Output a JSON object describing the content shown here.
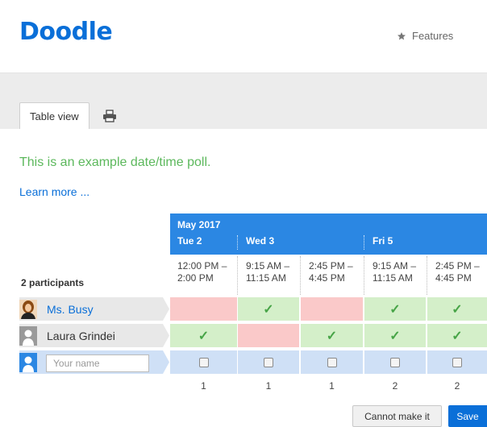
{
  "app": {
    "logo": "Doodle",
    "features_label": "Features"
  },
  "tabs": [
    {
      "label": "Table view"
    }
  ],
  "poll": {
    "title": "This is an example date/time poll.",
    "learn_more": "Learn more ..."
  },
  "calendar": {
    "month": "May 2017",
    "days": [
      "Tue 2",
      "Wed 3",
      "Fri 5"
    ],
    "participants_label": "2 participants",
    "slots": [
      {
        "start": "12:00 PM –",
        "end": "2:00 PM"
      },
      {
        "start": "9:15 AM –",
        "end": "11:15 AM"
      },
      {
        "start": "2:45 PM –",
        "end": "4:45 PM"
      },
      {
        "start": "9:15 AM –",
        "end": "11:15 AM"
      },
      {
        "start": "2:45 PM –",
        "end": "4:45 PM"
      }
    ],
    "counts": [
      "1",
      "1",
      "1",
      "2",
      "2"
    ]
  },
  "participants": [
    {
      "name": "Ms. Busy",
      "answers": [
        "no",
        "yes",
        "no",
        "yes",
        "yes"
      ]
    },
    {
      "name": "Laura Grindei",
      "answers": [
        "yes",
        "no",
        "yes",
        "yes",
        "yes"
      ]
    }
  ],
  "new_participant": {
    "placeholder": "Your name"
  },
  "buttons": {
    "cannot_make_it": "Cannot make it",
    "save": "Save"
  },
  "colors": {
    "brand": "#0a6fd8",
    "header_blue": "#2b87e3",
    "yes": "#d4efc9",
    "no": "#fac9c9",
    "input_row": "#cfe0f6",
    "title_green": "#5cb85c"
  },
  "icons": {
    "features": "star-icon",
    "print": "printer-icon",
    "check": "checkmark-icon",
    "avatar_busy": "avatar-woman-icon",
    "avatar_default": "avatar-default-icon"
  }
}
